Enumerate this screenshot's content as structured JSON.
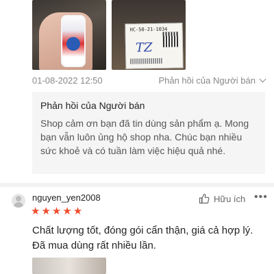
{
  "prev_review": {
    "date": "01-08-2022 12:50",
    "seller_reply_toggle": "Phản hồi của Người bán",
    "label_code": "HC-50-21-1034",
    "label_scribble": "TZ",
    "seller_reply": {
      "title": "Phản hồi của Người bán",
      "text": "Shop cảm ơn bạn đã tin dùng sản phẩm ạ. Mong bạn vẫn luôn ủng hộ shop nha. Chúc bạn nhiều sức khoẻ và có tuần làm việc hiệu quả nhé."
    }
  },
  "review": {
    "username": "nguyen_yen2008",
    "rating": 5,
    "stars": [
      "★",
      "★",
      "★",
      "★",
      "★"
    ],
    "helpful_label": "Hữu ích",
    "more_label": "•••",
    "text_line1": "Chất lượng tốt, đóng gói cẩn thận, giá cả hợp lý.",
    "text_line2": "Đã mua dùng rất nhiều lần."
  },
  "colors": {
    "star": "#ee4d2d",
    "reply_bg": "#f5f5f5",
    "muted": "#888888"
  },
  "icons": [
    "avatar-icon",
    "thumb-up-icon",
    "more-dots-icon",
    "chevron-down-icon",
    "star-icon"
  ]
}
